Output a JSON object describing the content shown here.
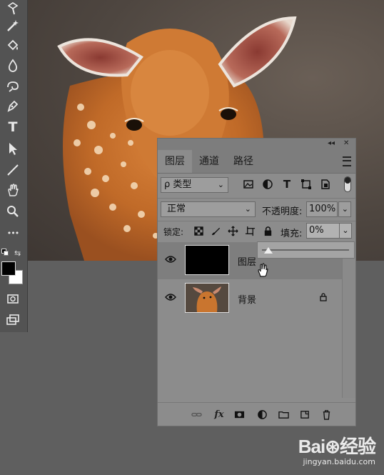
{
  "canvas": {
    "photo_description_icon": "deer-photo"
  },
  "toolbar": {
    "tools": [
      "rectangle-marquee-icon",
      "magic-wand-icon",
      "paint-bucket-icon",
      "blur-icon",
      "sponge-icon",
      "pen-icon",
      "type-icon",
      "path-selection-icon",
      "line-icon",
      "hand-icon",
      "zoom-icon",
      "more-icon"
    ],
    "type_glyph": "T",
    "more_glyph": "•••",
    "swap_glyph": "⇆"
  },
  "layers_panel": {
    "top_controls": {
      "collapse": "◂◂",
      "close": "✕"
    },
    "tabs": [
      {
        "label": "图层"
      },
      {
        "label": "通道"
      },
      {
        "label": "路径"
      }
    ],
    "filter": {
      "label": "ρ 类型",
      "caret": "⌄"
    },
    "filter_icons": [
      "image-filter-icon",
      "adjustment-filter-icon",
      "type-filter-icon",
      "shape-filter-icon",
      "smart-object-filter-icon"
    ],
    "blend_mode": {
      "value": "正常",
      "caret": "⌄"
    },
    "opacity": {
      "label": "不透明度:",
      "value": "100%",
      "caret": "⌄"
    },
    "lock": {
      "label": "锁定:"
    },
    "fill": {
      "label": "填充:",
      "value": "0%",
      "caret": "⌄",
      "slider_value": 0
    },
    "layers": [
      {
        "name": "图层",
        "thumb": "black",
        "selected": true
      },
      {
        "name": "背景",
        "thumb": "deer",
        "locked": true
      }
    ],
    "bottom_icons": [
      "link-layers-icon",
      "fx-icon",
      "add-mask-icon",
      "adjustment-layer-icon",
      "new-group-icon",
      "new-layer-icon",
      "delete-layer-icon"
    ],
    "fx_label": "fx"
  },
  "watermark": {
    "brand": "Bai⊛经验",
    "url": "jingyan.baidu.com"
  },
  "colors": {
    "panel_bg": "#8c8c8c",
    "tab_bar": "#7d7d7d",
    "selected_layer": "#7e7e7e",
    "workspace": "#5f5f5f"
  }
}
